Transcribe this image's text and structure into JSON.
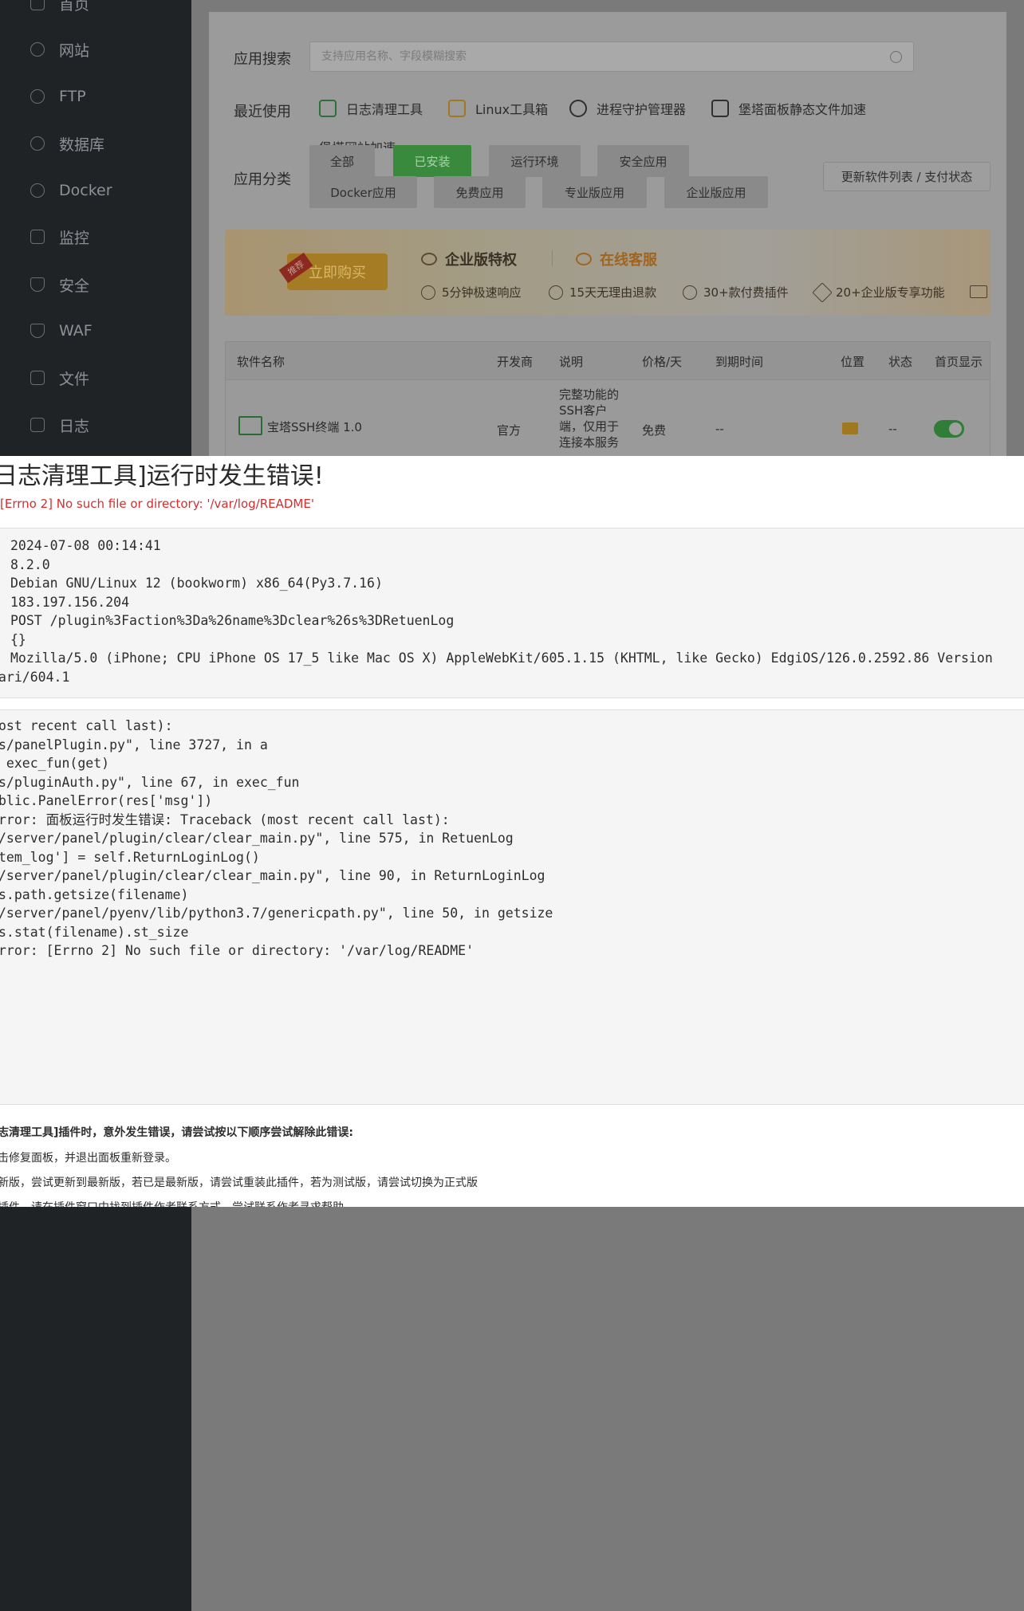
{
  "sidebar": {
    "items": [
      {
        "label": "首页",
        "icon": "home-icon"
      },
      {
        "label": "网站",
        "icon": "globe-icon"
      },
      {
        "label": "FTP",
        "icon": "ftp-icon"
      },
      {
        "label": "数据库",
        "icon": "database-icon"
      },
      {
        "label": "Docker",
        "icon": "docker-icon"
      },
      {
        "label": "监控",
        "icon": "monitor-icon"
      },
      {
        "label": "安全",
        "icon": "shield-icon"
      },
      {
        "label": "WAF",
        "icon": "waf-icon"
      },
      {
        "label": "文件",
        "icon": "folder-icon"
      },
      {
        "label": "日志",
        "icon": "log-icon"
      }
    ]
  },
  "appstore": {
    "search_label": "应用搜索",
    "search_placeholder": "支持应用名称、字段模糊搜索",
    "recent_label": "最近使用",
    "recent": [
      "日志清理工具",
      "Linux工具箱",
      "进程守护管理器",
      "堡塔面板静态文件加速"
    ],
    "recent_more": "堡塔网站加速",
    "category_label": "应用分类",
    "categories": [
      "全部",
      "已安装",
      "运行环境",
      "安全应用",
      "Docker应用",
      "免费应用",
      "专业版应用",
      "企业版应用"
    ],
    "active_category": "已安装",
    "update_button": "更新软件列表 / 支付状态"
  },
  "banner": {
    "buy_button": "立即购买",
    "buy_tag": "推荐",
    "enterprise_title": "企业版特权",
    "service_title": "在线客服",
    "features": [
      "5分钟极速响应",
      "15天无理由退款",
      "30+款付费插件",
      "20+企业版专享功能"
    ]
  },
  "table": {
    "headers": [
      "软件名称",
      "开发商",
      "说明",
      "价格/天",
      "到期时间",
      "位置",
      "状态",
      "首页显示"
    ],
    "row": {
      "name": "宝塔SSH终端 1.0",
      "developer": "官方",
      "description": "完整功能的SSH客户端，仅用于连接本服务",
      "desc_lines": [
        "完整功能的",
        "SSH客户",
        "端，仅用于",
        "连接本服务"
      ],
      "price": "免费",
      "expire": "--",
      "status": "--",
      "home_display": true
    }
  },
  "error": {
    "title": "日志清理工具]运行时发生错误!",
    "message": "[Errno 2] No such file or directory: '/var/log/README'",
    "info_lines": [
      "2024-07-08 00:14:41",
      "8.2.0",
      "Debian GNU/Linux 12 (bookworm) x86_64(Py3.7.16)",
      "183.197.156.204",
      "POST /plugin%3Faction%3Da%26name%3Dclear%26s%3DRetuenLog",
      "{}",
      "Mozilla/5.0 (iPhone; CPU iPhone OS 17_5 like Mac OS X) AppleWebKit/605.1.15 (KHTML, like Gecko) EdgiOS/126.0.2592.86 Version",
      "ari/604.1"
    ],
    "traceback_lines": [
      "ost recent call last):",
      "s/panelPlugin.py\", line 3727, in a",
      " exec_fun(get)",
      "s/pluginAuth.py\", line 67, in exec_fun",
      "blic.PanelError(res['msg'])",
      "rror: 面板运行时发生错误: Traceback (most recent call last):",
      "/server/panel/plugin/clear/clear_main.py\", line 575, in RetuenLog",
      "tem_log'] = self.ReturnLoginLog()",
      "/server/panel/plugin/clear/clear_main.py\", line 90, in ReturnLoginLog",
      "s.path.getsize(filename)",
      "/server/panel/pyenv/lib/python3.7/genericpath.py\", line 50, in getsize",
      "s.stat(filename).st_size",
      "rror: [Errno 2] No such file or directory: '/var/log/README'"
    ],
    "tips_heading": "志清理工具]插件时，意外发生错误，请尝试按以下顺序尝试解除此错误:",
    "tips": [
      "击修复面板，并退出面板重新登录。",
      "新版，尝试更新到最新版，若已是最新版，请尝试重装此插件，若为测试版，请尝试切换为正式版",
      "插件，请在插件窗口中找到插件作者联系方式，尝试联系作者寻求帮助"
    ]
  }
}
